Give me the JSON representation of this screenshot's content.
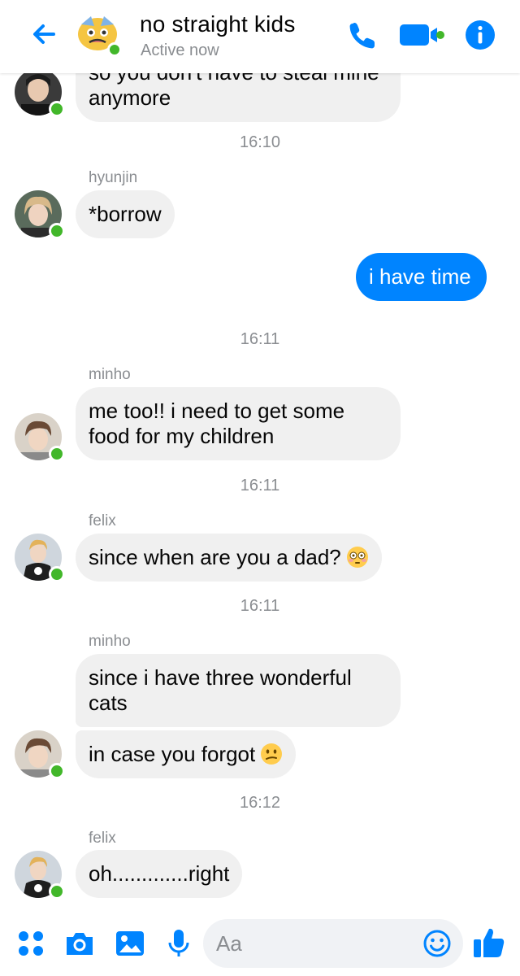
{
  "header": {
    "title": "no straight kids",
    "status": "Active now",
    "icons": [
      "back-arrow-icon",
      "phone-icon",
      "video-camera-icon",
      "info-icon"
    ]
  },
  "colors": {
    "accent": "#0084ff",
    "online": "#42b72a",
    "bubble_in": "#f0f0f0",
    "meta_text": "#8a8d91"
  },
  "messages": {
    "m0": {
      "text": "so you don't have to steal mine\nanymore"
    },
    "t1": "16:10",
    "m1": {
      "sender": "hyunjin",
      "text": "*borrow"
    },
    "m2": {
      "text": "i have time",
      "direction": "outgoing"
    },
    "t2": "16:11",
    "m3": {
      "sender": "minho",
      "text": "me too!! i need to get some\nfood for my children"
    },
    "t3": "16:11",
    "m4": {
      "sender": "felix",
      "text": "since when are you a dad?",
      "emoji": "flushed-face-emoji"
    },
    "t4": "16:11",
    "m5": {
      "sender": "minho",
      "text": "since i have three wonderful\ncats"
    },
    "m6": {
      "text": "in case you forgot",
      "emoji": "confused-face-emoji"
    },
    "t5": "16:12",
    "m7": {
      "sender": "felix",
      "text": "oh.............right"
    }
  },
  "composer": {
    "placeholder": "Aa",
    "icons": [
      "apps-icon",
      "camera-icon",
      "gallery-icon",
      "microphone-icon",
      "emoji-icon",
      "like-icon"
    ]
  }
}
